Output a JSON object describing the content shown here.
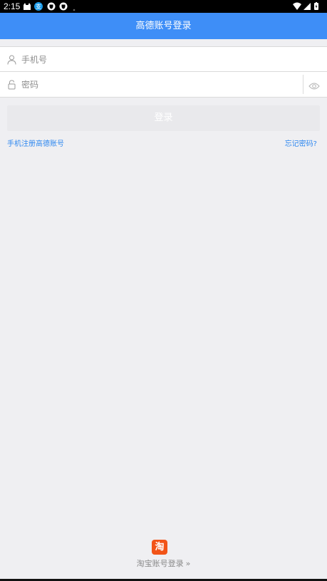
{
  "status_bar": {
    "time": "2:15"
  },
  "header": {
    "title": "高德账号登录"
  },
  "phone_field": {
    "placeholder": "手机号"
  },
  "password_field": {
    "placeholder": "密码"
  },
  "login_button": {
    "label": "登录"
  },
  "links": {
    "register": "手机注册高德账号",
    "forgot": "忘记密码?"
  },
  "taobao": {
    "icon_text": "淘",
    "label": "淘宝账号登录",
    "chevron": "»"
  },
  "colors": {
    "header_bg": "#3e8ef7",
    "link": "#2f88f0",
    "taobao": "#f25418"
  }
}
